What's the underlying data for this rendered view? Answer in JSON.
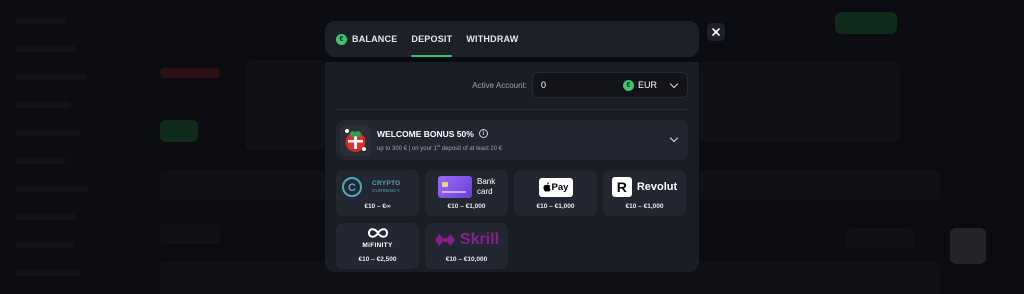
{
  "tabs": {
    "balance": "BALANCE",
    "deposit": "DEPOSIT",
    "withdraw": "WITHDRAW",
    "active": "DEPOSIT"
  },
  "account": {
    "label": "Active Account:",
    "value": "0",
    "currency": "EUR",
    "currency_symbol": "€"
  },
  "bonus": {
    "title": "WELCOME BONUS 50%",
    "subtitle_pre": "up to 300 € | on your 1",
    "subtitle_sup": "st",
    "subtitle_post": " deposit of at least 20 €"
  },
  "payment_methods": [
    {
      "name": "crypto",
      "logo_line1": "CRYPTO",
      "logo_line2": "CURRENCY",
      "range": "€10 – €∞"
    },
    {
      "name": "bank-card",
      "logo_line1": "Bank",
      "logo_line2": "card",
      "range": "€10 – €1,000"
    },
    {
      "name": "apple-pay",
      "logo_text": "Pay",
      "range": "€10 – €1,000"
    },
    {
      "name": "revolut",
      "logo_text": "Revolut",
      "logo_mark": "R",
      "range": "€10 – €1,000"
    },
    {
      "name": "mifinity",
      "logo_text": "MiFINITY",
      "range": "€10 – €2,500"
    },
    {
      "name": "skrill",
      "logo_text": "Skrill",
      "range": "€10 – €10,000"
    }
  ],
  "colors": {
    "accent_green": "#36c46a",
    "modal_bg": "#1a1d24",
    "card_bg": "#232731",
    "crypto_teal": "#4fa9b6",
    "bank_card_purple": "#8a5cf0",
    "skrill_purple": "#8a1f8d"
  },
  "icons": {
    "close": "close-icon",
    "info": "info-icon",
    "chevron": "chevron-down-icon"
  }
}
